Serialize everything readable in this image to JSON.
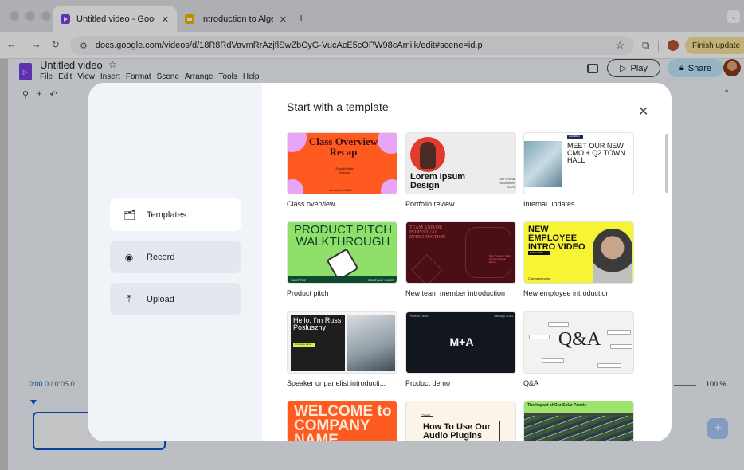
{
  "browser": {
    "tabs": [
      {
        "title": "Untitled video - Google Vids",
        "close": "✕"
      },
      {
        "title": "Introduction to Algebra: Fall S",
        "close": "✕"
      }
    ],
    "new_tab": "+",
    "menu": "⌄",
    "url": "docs.google.com/videos/d/18R8RdVavmRrAzjflSwZbCyG-VucAcE5cOPW98cAmiik/edit#scene=id.p",
    "finish_update": "Finish update"
  },
  "app": {
    "title": "Untitled video",
    "menus": [
      "File",
      "Edit",
      "View",
      "Insert",
      "Format",
      "Scene",
      "Arrange",
      "Tools",
      "Help"
    ],
    "play_label": "Play",
    "share_label": "Share",
    "time": "0:00.0",
    "duration": "/ 0:05.0",
    "zoom": "100 %"
  },
  "dialog": {
    "heading": "Start with a template",
    "close": "✕",
    "side_items": [
      {
        "label": "Templates",
        "icon": "templates-icon"
      },
      {
        "label": "Record",
        "icon": "record-icon"
      },
      {
        "label": "Upload",
        "icon": "upload-icon"
      }
    ],
    "templates": [
      {
        "caption": "Class overview"
      },
      {
        "caption": "Portfolio review"
      },
      {
        "caption": "Internal updates"
      },
      {
        "caption": "Product pitch"
      },
      {
        "caption": "New team member introduction"
      },
      {
        "caption": "New employee introduction"
      },
      {
        "caption": "Speaker or panelist introducti..."
      },
      {
        "caption": "Product demo"
      },
      {
        "caption": "Q&A"
      },
      {
        "caption": ""
      },
      {
        "caption": ""
      },
      {
        "caption": ""
      }
    ],
    "thumb_text": {
      "class_title": "Class Overview Recap",
      "class_sub": "English Math Science",
      "class_date": "January 9, 2024",
      "portfolio_title": "Lorem Ipsum Design",
      "portfolio_meta": "Jon Rocha November 2024",
      "internal_tag": "April 2024",
      "internal_title": "MEET OUR NEW CMO + Q2 TOWN HALL",
      "pitch_title": "PRODUCT PITCH WALKTHROUGH",
      "pitch_sub": "SUBTITLE",
      "pitch_company": "COMPANY NAME",
      "team_title": "TEAM AND/OR INDIVIDUAL INTRODUCTION",
      "team_list": "Web Producer Sales Manager Social Expert",
      "employee_title": "NEW EMPLOYEE INTRO VIDEO",
      "employee_date": "DATE HERE",
      "employee_company": "Company name",
      "speaker_title": "Hello, I'm Russ Posluszny",
      "speaker_badge": "Company name",
      "demo_label": "Product Demo",
      "demo_date": "January 2024",
      "demo_title": "M+A",
      "qa_title": "Q&A",
      "welcome_title": "WELCOME to COMPANY NAME",
      "audio_tag": "Tutorial",
      "audio_title": "How To Use Our Audio Plugins",
      "solar_title": "The Impact of Our Solar Panels"
    }
  }
}
